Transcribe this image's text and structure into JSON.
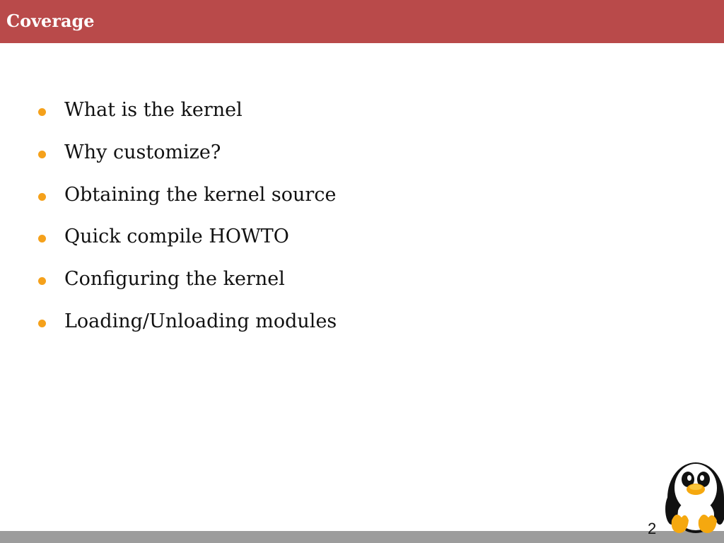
{
  "slide": {
    "title": "Coverage",
    "page_number": "2",
    "bullets": [
      "What is the kernel",
      "Why customize?",
      "Obtaining the kernel source",
      "Quick compile HOWTO",
      "Configuring the kernel",
      "Loading/Unloading modules"
    ],
    "mascot_icon": "penguin-icon"
  },
  "colors": {
    "title_bar": "#b94a4a",
    "bullet": "#f5a11b",
    "footer_bar": "#9c9c9c",
    "text": "#111111"
  }
}
